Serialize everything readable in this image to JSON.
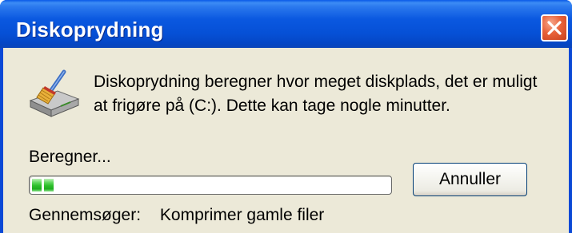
{
  "window": {
    "title": "Diskoprydning",
    "close_icon": "close-icon"
  },
  "main": {
    "message": "Diskoprydning beregner hvor meget diskplads, det er muligt at frigøre på  (C:). Dette kan tage nogle minutter.",
    "icon": "disk-cleanup-icon",
    "status_label": "Beregner...",
    "progress_fraction": 0.06,
    "cancel_label": "Annuller",
    "scan_label": "Gennemsøger:",
    "scan_value": "Komprimer gamle filer"
  },
  "colors": {
    "titlebar": "#0a58e0",
    "client_background": "#ece9d8",
    "progress_green": "#2cbe2a",
    "close_button": "#e8623a"
  }
}
